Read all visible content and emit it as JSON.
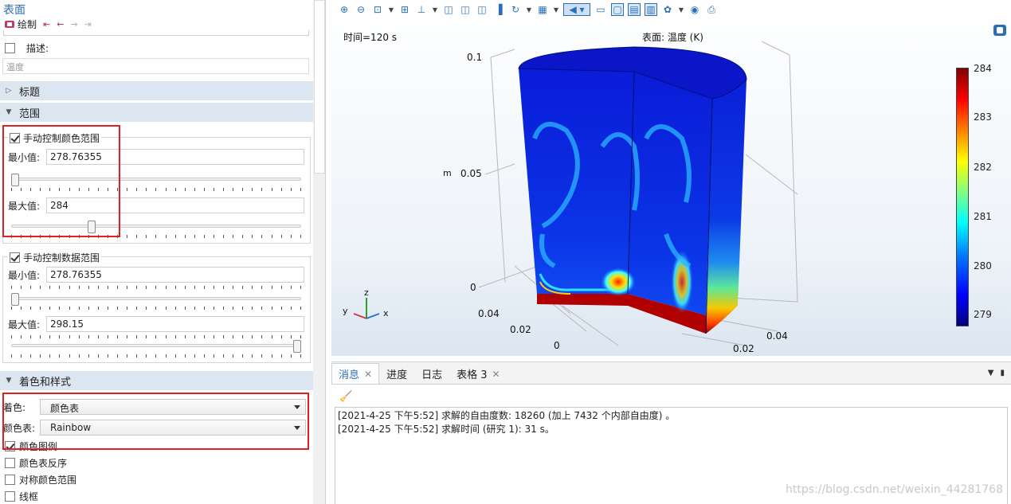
{
  "left_panel": {
    "title": "表面",
    "plot_label": "绘制",
    "nav": [
      "⇤",
      "←",
      "→",
      "⇥"
    ],
    "description_label": "描述:",
    "description_value": "温度",
    "sections": {
      "title": "标题",
      "range": "范围",
      "coloring": "着色和样式"
    },
    "color_range": {
      "label": "手动控制颜色范围",
      "checked": true,
      "min_label": "最小值:",
      "min_value": "278.76355",
      "max_label": "最大值:",
      "max_value": "284",
      "min_slider_fraction": 0.0,
      "max_slider_fraction": 0.27
    },
    "data_range": {
      "label": "手动控制数据范围",
      "checked": true,
      "min_label": "最小值:",
      "min_value": "278.76355",
      "max_label": "最大值:",
      "max_value": "298.15",
      "min_slider_fraction": 0.0,
      "max_slider_fraction": 1.0
    },
    "coloring": {
      "coloring_label": "着色:",
      "coloring_value": "颜色表",
      "colortable_label": "颜色表:",
      "colortable_value": "Rainbow",
      "legend_label": "颜色图例",
      "legend_checked": true,
      "reverse_label": "颜色表反序",
      "symmetric_label": "对称颜色范围",
      "wireframe_label": "线框"
    }
  },
  "graphics": {
    "time_label": "时间=120 s",
    "surface_label": "表面: 温度 (K)",
    "z_axis_ticks": [
      "0.1",
      "0.05",
      "0"
    ],
    "z_unit": "m",
    "y_axis_ticks": [
      "0.04",
      "0.02",
      "0"
    ],
    "x_axis_ticks": [
      "0.02",
      "0.04"
    ],
    "triad": {
      "x": "x",
      "y": "y",
      "z": "z"
    },
    "colorbar": {
      "colormap": "Rainbow",
      "ticks": [
        "284",
        "283",
        "282",
        "281",
        "280",
        "279"
      ]
    }
  },
  "messages": {
    "tabs": [
      "消息",
      "进度",
      "日志",
      "表格 3"
    ],
    "lines": [
      "[2021-4-25 下午5:52] 求解的自由度数: 18260 (加上 7432 个内部自由度) 。",
      "[2021-4-25 下午5:52] 求解时间 (研究 1): 31 s。"
    ],
    "watermark": "https://blog.csdn.net/weixin_44281768"
  }
}
